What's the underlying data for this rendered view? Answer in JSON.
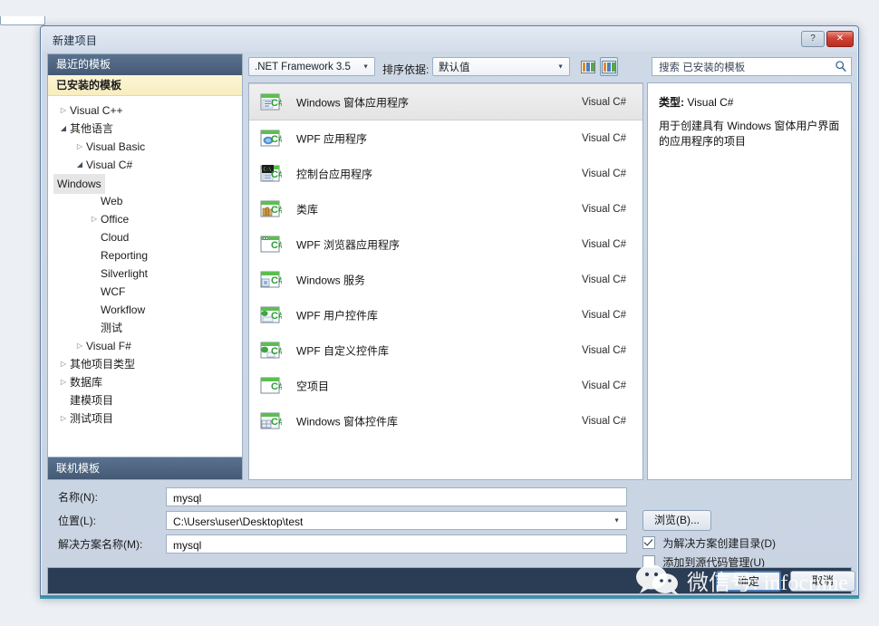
{
  "window": {
    "title": "新建项目",
    "help_button": "?",
    "close_button": "✕"
  },
  "sidebar": {
    "recent_header": "最近的模板",
    "installed_header": "已安装的模板",
    "online_header": "联机模板",
    "tree": [
      {
        "label": "Visual C++",
        "level": 0,
        "arrow": "closed",
        "selected": false
      },
      {
        "label": "其他语言",
        "level": 0,
        "arrow": "open",
        "selected": false
      },
      {
        "label": "Visual Basic",
        "level": 1,
        "arrow": "closed",
        "selected": false
      },
      {
        "label": "Visual C#",
        "level": 1,
        "arrow": "open",
        "selected": false
      },
      {
        "label": "Windows",
        "level": 2,
        "arrow": "none",
        "selected": true
      },
      {
        "label": "Web",
        "level": 2,
        "arrow": "none",
        "selected": false
      },
      {
        "label": "Office",
        "level": 2,
        "arrow": "closed",
        "selected": false
      },
      {
        "label": "Cloud",
        "level": 2,
        "arrow": "none",
        "selected": false
      },
      {
        "label": "Reporting",
        "level": 2,
        "arrow": "none",
        "selected": false
      },
      {
        "label": "Silverlight",
        "level": 2,
        "arrow": "none",
        "selected": false
      },
      {
        "label": "WCF",
        "level": 2,
        "arrow": "none",
        "selected": false
      },
      {
        "label": "Workflow",
        "level": 2,
        "arrow": "none",
        "selected": false
      },
      {
        "label": "测试",
        "level": 2,
        "arrow": "none",
        "selected": false
      },
      {
        "label": "Visual F#",
        "level": 1,
        "arrow": "closed",
        "selected": false
      },
      {
        "label": "其他项目类型",
        "level": 0,
        "arrow": "closed",
        "selected": false
      },
      {
        "label": "数据库",
        "level": 0,
        "arrow": "closed",
        "selected": false
      },
      {
        "label": "建模项目",
        "level": 0,
        "arrow": "none",
        "selected": false
      },
      {
        "label": "测试项目",
        "level": 0,
        "arrow": "closed",
        "selected": false
      }
    ]
  },
  "toolbar": {
    "framework_value": ".NET Framework 3.5",
    "sort_label": "排序依据:",
    "sort_value": "默认值",
    "view_small_tooltip": "小图标",
    "view_medium_tooltip": "中等图标",
    "dropdown_arrow": "▼"
  },
  "search": {
    "placeholder": "搜索 已安装的模板",
    "value": ""
  },
  "templates": [
    {
      "name": "Windows 窗体应用程序",
      "lang": "Visual C#",
      "icon": "winforms-app-icon",
      "selected": true
    },
    {
      "name": "WPF 应用程序",
      "lang": "Visual C#",
      "icon": "wpf-app-icon",
      "selected": false
    },
    {
      "name": "控制台应用程序",
      "lang": "Visual C#",
      "icon": "console-app-icon",
      "selected": false
    },
    {
      "name": "类库",
      "lang": "Visual C#",
      "icon": "class-library-icon",
      "selected": false
    },
    {
      "name": "WPF 浏览器应用程序",
      "lang": "Visual C#",
      "icon": "wpf-browser-icon",
      "selected": false
    },
    {
      "name": "Windows 服务",
      "lang": "Visual C#",
      "icon": "windows-service-icon",
      "selected": false
    },
    {
      "name": "WPF 用户控件库",
      "lang": "Visual C#",
      "icon": "wpf-usercontrol-icon",
      "selected": false
    },
    {
      "name": "WPF 自定义控件库",
      "lang": "Visual C#",
      "icon": "wpf-customctrl-icon",
      "selected": false
    },
    {
      "name": "空项目",
      "lang": "Visual C#",
      "icon": "empty-project-icon",
      "selected": false
    },
    {
      "name": "Windows 窗体控件库",
      "lang": "Visual C#",
      "icon": "winforms-ctrl-icon",
      "selected": false
    }
  ],
  "description": {
    "type_label": "类型:",
    "type_value": "Visual C#",
    "body": "用于创建具有 Windows 窗体用户界面的应用程序的项目"
  },
  "form": {
    "name_label": "名称(N):",
    "name_value": "mysql",
    "location_label": "位置(L):",
    "location_value": "C:\\Users\\user\\Desktop\\test",
    "solution_label": "解决方案名称(M):",
    "solution_value": "mysql",
    "browse_button": "浏览(B)...",
    "create_dir_label": "为解决方案创建目录(D)",
    "create_dir_checked": true,
    "add_scc_label": "添加到源代码管理(U)",
    "add_scc_checked": false
  },
  "footer": {
    "ok_button": "确定",
    "cancel_button": "取消"
  },
  "watermark": {
    "text": "微信号: infocrime",
    "logo": "wechat-logo-icon"
  },
  "colors": {
    "accent_blue": "#445974",
    "installed_highlight": "#f8edc0",
    "close_red": "#cf4236",
    "selection_gray": "#e8e8e8",
    "footer_band": "#2b3c55",
    "bottom_edge_teal": "#2f8ba3"
  }
}
